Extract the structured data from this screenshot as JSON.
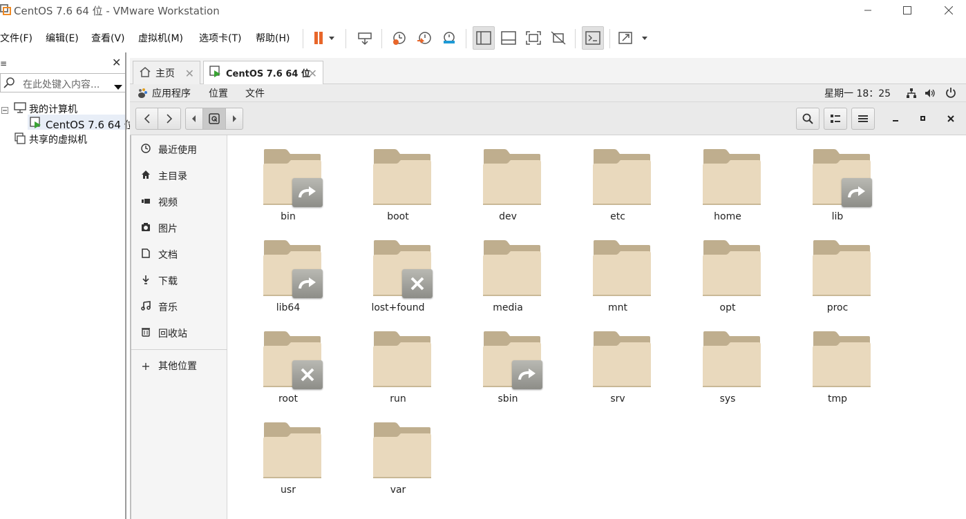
{
  "window": {
    "title": "CentOS 7.6 64 位 - VMware Workstation"
  },
  "menubar": {
    "items": [
      "文件(F)",
      "编辑(E)",
      "查看(V)",
      "虚拟机(M)",
      "选项卡(T)",
      "帮助(H)"
    ]
  },
  "library": {
    "search_placeholder": "在此处键入内容...",
    "tree": {
      "my_computer": "我的计算机",
      "vm": "CentOS 7.6 64 位",
      "shared": "共享的虚拟机"
    }
  },
  "tabs": {
    "home": "主页",
    "vm": "CentOS 7.6 64 位"
  },
  "gnome": {
    "applications": "应用程序",
    "places": "位置",
    "files": "文件",
    "clock": "星期一 18：25"
  },
  "sidebar": {
    "items": [
      {
        "label": "最近使用",
        "icon": "clock-icon"
      },
      {
        "label": "主目录",
        "icon": "home-icon"
      },
      {
        "label": "视频",
        "icon": "video-icon"
      },
      {
        "label": "图片",
        "icon": "camera-icon"
      },
      {
        "label": "文档",
        "icon": "document-icon"
      },
      {
        "label": "下载",
        "icon": "download-icon"
      },
      {
        "label": "音乐",
        "icon": "music-icon"
      },
      {
        "label": "回收站",
        "icon": "trash-icon"
      }
    ],
    "other": "其他位置"
  },
  "files": [
    {
      "name": "bin",
      "emblem": "symlink"
    },
    {
      "name": "boot",
      "emblem": ""
    },
    {
      "name": "dev",
      "emblem": ""
    },
    {
      "name": "etc",
      "emblem": ""
    },
    {
      "name": "home",
      "emblem": ""
    },
    {
      "name": "lib",
      "emblem": "symlink"
    },
    {
      "name": "lib64",
      "emblem": "symlink"
    },
    {
      "name": "lost+found",
      "emblem": "locked"
    },
    {
      "name": "media",
      "emblem": ""
    },
    {
      "name": "mnt",
      "emblem": ""
    },
    {
      "name": "opt",
      "emblem": ""
    },
    {
      "name": "proc",
      "emblem": ""
    },
    {
      "name": "root",
      "emblem": "locked"
    },
    {
      "name": "run",
      "emblem": ""
    },
    {
      "name": "sbin",
      "emblem": "symlink"
    },
    {
      "name": "srv",
      "emblem": ""
    },
    {
      "name": "sys",
      "emblem": ""
    },
    {
      "name": "tmp",
      "emblem": ""
    },
    {
      "name": "usr",
      "emblem": ""
    },
    {
      "name": "var",
      "emblem": ""
    }
  ],
  "colors": {
    "pause": "#e8662a",
    "folder_front": "#e9d9bd",
    "folder_back": "#bfae8e"
  }
}
